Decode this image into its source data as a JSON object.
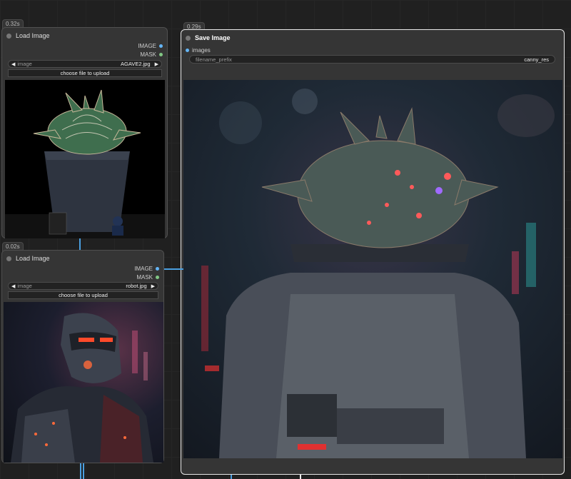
{
  "nodes": {
    "load_image_1": {
      "timing": "0.32s",
      "title": "Load Image",
      "outputs": [
        "IMAGE",
        "MASK"
      ],
      "combo_label": "image",
      "combo_value": "AGAVE2.jpg",
      "upload_label": "choose file to upload",
      "preview_icon": "agave-cactus-image"
    },
    "load_image_2": {
      "timing": "0.02s",
      "title": "Load Image",
      "outputs": [
        "IMAGE",
        "MASK"
      ],
      "combo_label": "image",
      "combo_value": "robot.jpg",
      "upload_label": "choose file to upload",
      "preview_icon": "cyberpunk-robot-image"
    },
    "save_image": {
      "timing": "0.29s",
      "title": "Save Image",
      "input": "images",
      "prefix_label": "filename_prefix",
      "prefix_value": "canny_res",
      "preview_icon": "cactus-robot-result-image"
    }
  },
  "colors": {
    "canvas_bg": "#202020",
    "node_bg": "#353535",
    "image_link": "#64b5f6",
    "mask_link": "#81c784",
    "selected_border": "#e8e8e8"
  }
}
